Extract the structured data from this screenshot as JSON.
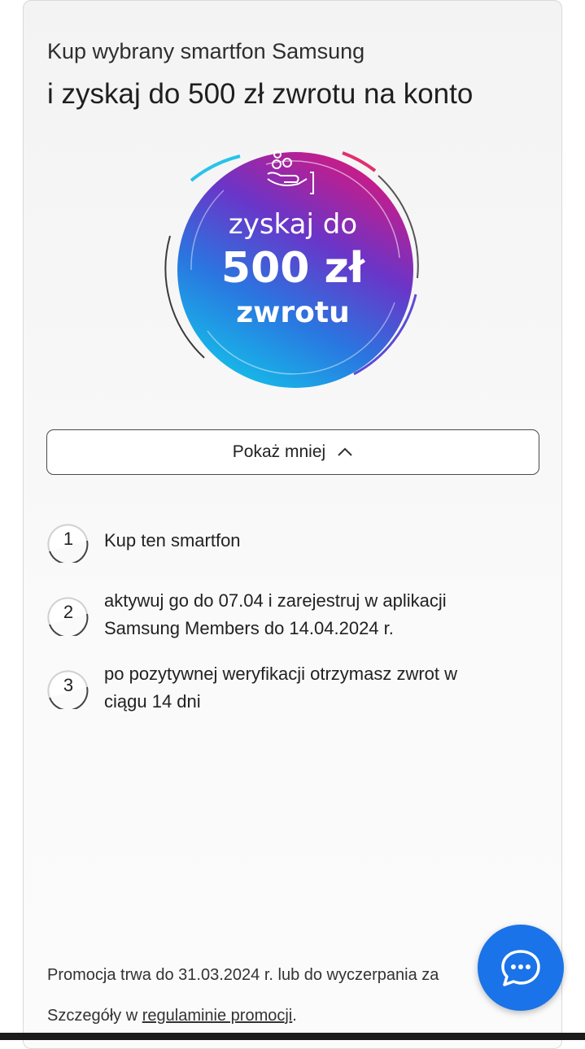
{
  "promo": {
    "subtitle": "Kup wybrany smartfon Samsung",
    "title": "i zyskaj do 500 zł zwrotu na konto"
  },
  "badge": {
    "line1": "zyskaj do",
    "line2": "500 zł",
    "line3": "zwrotu",
    "icon": "hand-coins-icon",
    "gradient_colors": [
      "#d6187f",
      "#5a3fd0",
      "#1e9be8",
      "#13c4ea"
    ]
  },
  "toggle": {
    "label": "Pokaż mniej",
    "icon": "chevron-up-icon"
  },
  "steps": [
    {
      "number": "1",
      "line1": "Kup ten smartfon",
      "line2": ""
    },
    {
      "number": "2",
      "line1": "aktywuj go do 07.04 i zarejestruj w aplikacji",
      "line2": "Samsung Members do 14.04.2024 r."
    },
    {
      "number": "3",
      "line1": "po pozytywnej weryfikacji otrzymasz zwrot w",
      "line2": "ciągu 14 dni"
    }
  ],
  "footer": {
    "duration_text": "Promocja trwa do 31.03.2024 r. lub do wyczerpania za",
    "details_prefix": "Szczegóły w ",
    "details_link": "regulaminie promocji",
    "details_suffix": "."
  },
  "chat": {
    "icon": "chat-bubble-icon",
    "color": "#1a73e8"
  }
}
